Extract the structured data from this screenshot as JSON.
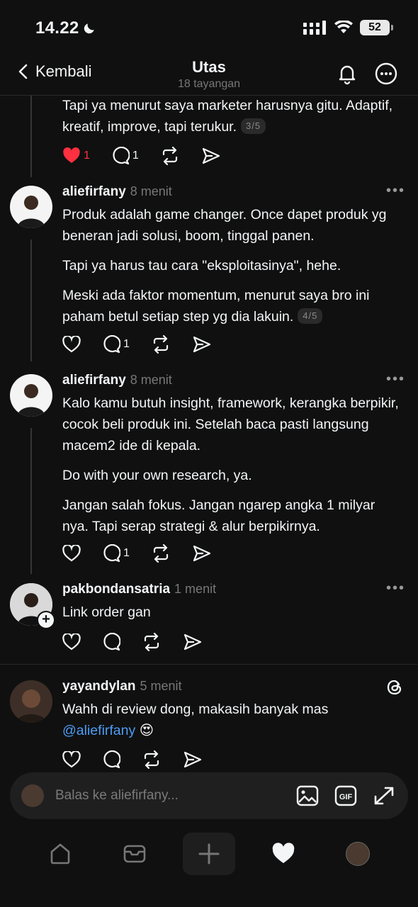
{
  "status_bar": {
    "time": "14.22",
    "battery": "52"
  },
  "header": {
    "back_label": "Kembali",
    "title": "Utas",
    "subtitle": "18 tayangan"
  },
  "posts": [
    {
      "paragraphs": [
        "Tapi ya menurut saya marketer harusnya gitu. Adaptif, kreatif, improve, tapi terukur."
      ],
      "pager": "3/5",
      "likes": "1",
      "replies": "1",
      "liked": true
    },
    {
      "username": "aliefirfany",
      "time": "8 menit",
      "paragraphs": [
        "Produk adalah game changer. Once dapet produk yg beneran jadi solusi, boom, tinggal panen.",
        "Tapi ya harus tau cara \"eksploitasinya\", hehe.",
        "Meski ada faktor momentum, menurut saya bro ini paham betul setiap step yg dia lakuin."
      ],
      "pager": "4/5",
      "replies": "1"
    },
    {
      "username": "aliefirfany",
      "time": "8 menit",
      "paragraphs": [
        "Kalo kamu butuh insight, framework, kerangka berpikir, cocok beli produk ini. Setelah baca pasti langsung macem2 ide di kepala.",
        "Do with your own research, ya.",
        "Jangan salah fokus. Jangan ngarep angka 1 milyar nya. Tapi serap strategi & alur berpikirnya."
      ],
      "replies": "1"
    },
    {
      "username": "pakbondansatria",
      "time": "1 menit",
      "paragraphs": [
        "Link order gan"
      ]
    },
    {
      "username": "yayandylan",
      "time": "5 menit",
      "text_before": "Wahh di review dong, makasih banyak mas ",
      "mention": "@aliefirfany",
      "emoji": "😍"
    }
  ],
  "reply_bar": {
    "placeholder": "Balas ke aliefirfany..."
  },
  "icons": {
    "back": "chevron-left-icon",
    "bell": "bell-icon",
    "more": "more-circle-icon",
    "like": "heart-icon",
    "reply": "comment-icon",
    "repost": "repost-icon",
    "share": "send-icon",
    "threads": "threads-logo-icon",
    "image": "image-icon",
    "gif": "gif-icon",
    "expand": "expand-icon",
    "home": "home-icon",
    "inbox": "inbox-icon",
    "compose": "plus-icon",
    "activity": "heart-filled-icon",
    "profile": "profile-avatar"
  },
  "colors": {
    "background": "#101010",
    "accent_like": "#ff3040",
    "mention": "#4d9df5",
    "muted": "#777777"
  }
}
